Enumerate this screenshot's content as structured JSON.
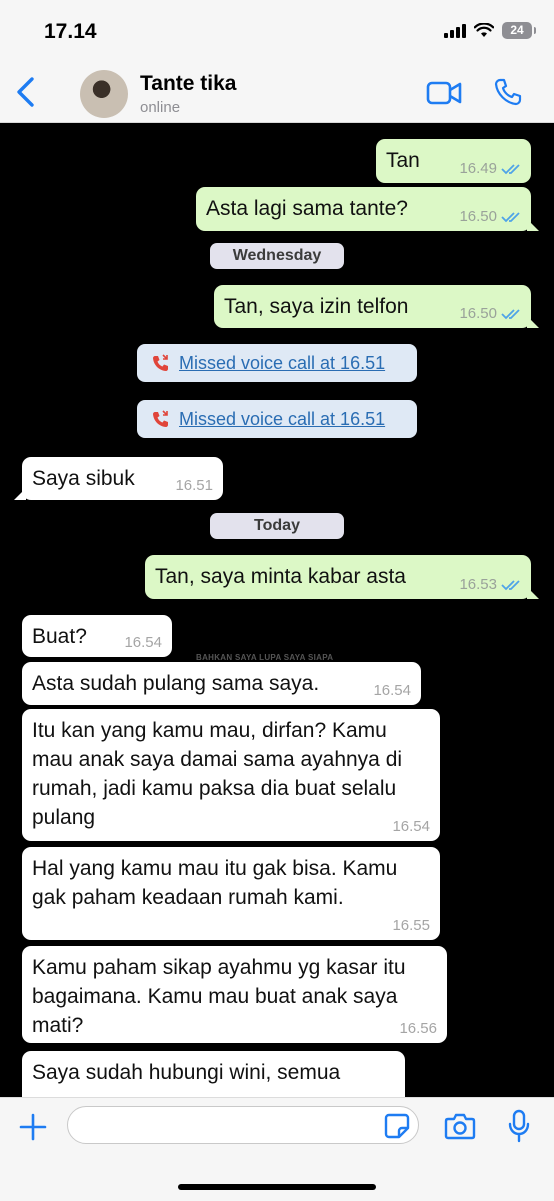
{
  "status_bar": {
    "time": "17.14",
    "battery": "24"
  },
  "header": {
    "contact_name": "Tante tika",
    "contact_status": "online"
  },
  "chat": {
    "day_wednesday": "Wednesday",
    "day_today": "Today",
    "overlay_text": "BAHKAN SAYA LUPA SAYA SIAPA",
    "messages": [
      {
        "text": "Tan",
        "time": "16.49"
      },
      {
        "text": "Asta lagi sama tante?",
        "time": "16.50"
      },
      {
        "text": "Tan, saya izin telfon",
        "time": "16.50"
      },
      {
        "text": "Missed voice call at 16.51"
      },
      {
        "text": "Missed voice call at 16.51"
      },
      {
        "text": "Saya sibuk",
        "time": "16.51"
      },
      {
        "text": "Tan, saya minta kabar asta",
        "time": "16.53"
      },
      {
        "text": "Buat?",
        "time": "16.54"
      },
      {
        "text": "Asta sudah pulang sama saya.",
        "time": "16.54"
      },
      {
        "text": "Itu kan yang kamu mau, dirfan? Kamu mau anak saya damai sama ayahnya di rumah, jadi kamu paksa dia buat selalu pulang",
        "time": "16.54"
      },
      {
        "text": "Hal yang kamu mau itu gak bisa. Kamu gak paham keadaan rumah kami.",
        "time": "16.55"
      },
      {
        "text": "Kamu paham sikap ayahmu yg kasar itu bagaimana. Kamu mau buat anak saya mati?",
        "time": "16.56"
      },
      {
        "text": "Saya sudah hubungi wini, semua",
        "time": ""
      }
    ]
  },
  "input_bar": {
    "placeholder": ""
  },
  "colors": {
    "outgoing": "#dcf8c6",
    "incoming": "#ffffff",
    "accent": "#1e7cf2",
    "read_ticks": "#4fa3e8"
  }
}
